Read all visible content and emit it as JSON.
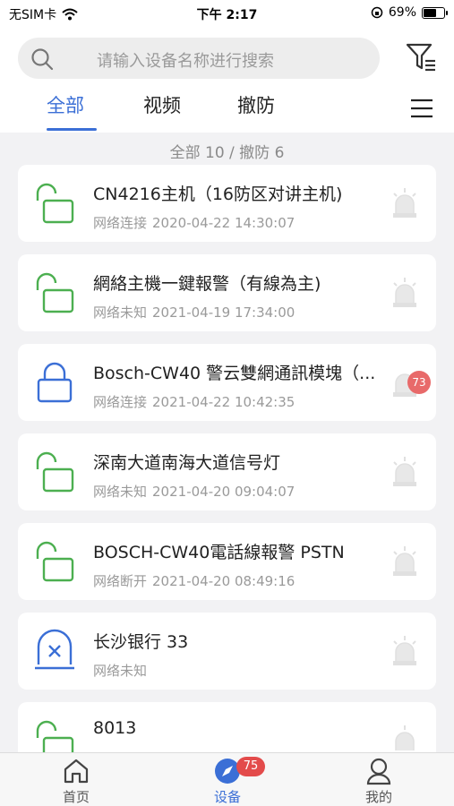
{
  "status_bar": {
    "carrier": "无SIM卡",
    "time": "下午 2:17",
    "battery": "69%",
    "battery_level": 0.69
  },
  "search": {
    "placeholder": "请输入设备名称进行搜索"
  },
  "tabs": [
    {
      "label": "全部",
      "active": true
    },
    {
      "label": "视频",
      "active": false
    },
    {
      "label": "撤防",
      "active": false
    }
  ],
  "summary": "全部 10 / 撤防 6",
  "devices": [
    {
      "name": "CN4216主机（16防区对讲主机)",
      "network": "网络连接",
      "time": "2020-04-22 14:30:07",
      "icon": "unlock-icon",
      "color": "#4caf50"
    },
    {
      "name": "網絡主機一鍵報警（有線為主)",
      "network": "网络未知",
      "time": "2021-04-19 17:34:00",
      "icon": "unlock-icon",
      "color": "#4caf50"
    },
    {
      "name": "Bosch-CW40 警云雙網通訊模塊（...",
      "network": "网络连接",
      "time": "2021-04-22 10:42:35",
      "icon": "lock-icon",
      "color": "#3b6fd6",
      "badge": "73"
    },
    {
      "name": "深南大道南海大道信号灯",
      "network": "网络未知",
      "time": "2021-04-20 09:04:07",
      "icon": "unlock-icon",
      "color": "#4caf50"
    },
    {
      "name": "BOSCH-CW40電話線報警 PSTN",
      "network": "网络断开",
      "time": "2021-04-20 08:49:16",
      "icon": "unlock-icon",
      "color": "#4caf50"
    },
    {
      "name": "长沙银行 33",
      "network": "网络未知",
      "time": "",
      "icon": "disconnected-icon",
      "color": "#3b6fd6"
    },
    {
      "name": "8013",
      "network": "",
      "time": "",
      "icon": "unlock-icon",
      "color": "#4caf50"
    }
  ],
  "bottom_nav": [
    {
      "label": "首页",
      "icon": "home-icon",
      "active": false
    },
    {
      "label": "设备",
      "icon": "compass-icon",
      "active": true,
      "badge": "75"
    },
    {
      "label": "我的",
      "icon": "user-icon",
      "active": false
    }
  ]
}
